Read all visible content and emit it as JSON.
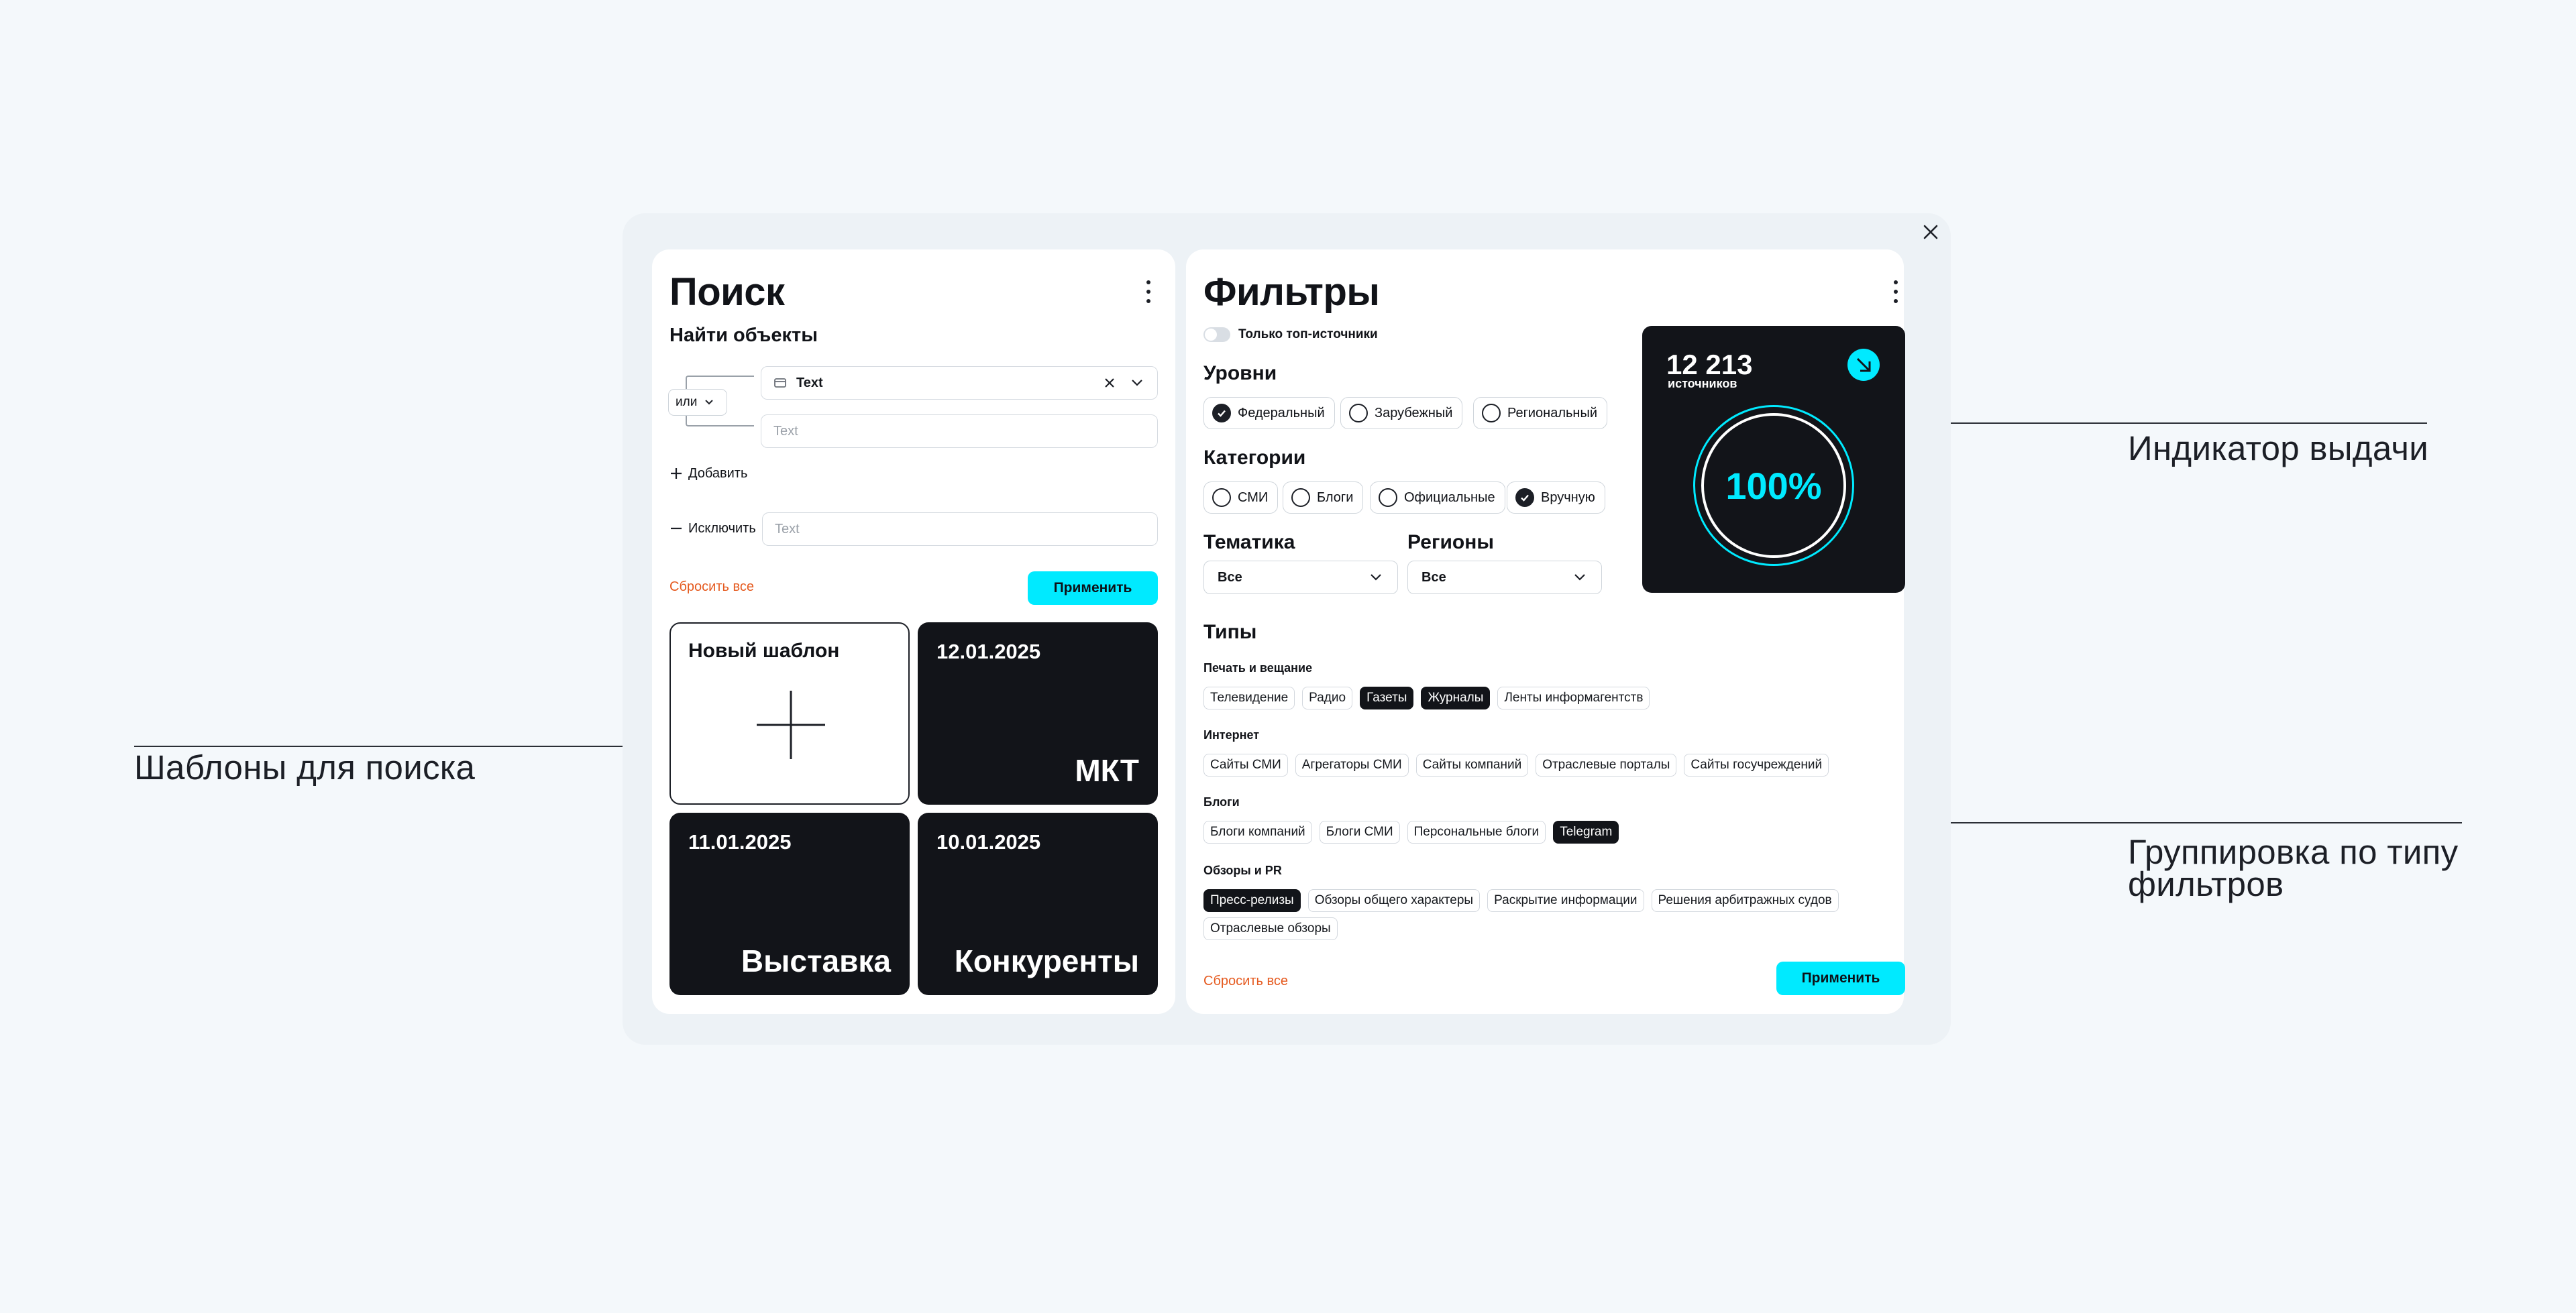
{
  "annotations": {
    "templates": "Шаблоны для поиска",
    "indicator": "Индикатор выдачи",
    "grouping_line1": "Группировка по типу",
    "grouping_line2": "фильтров"
  },
  "search": {
    "title": "Поиск",
    "subtitle": "Найти объекты",
    "logic_operator": "или",
    "field1_value": "Text",
    "field2_placeholder": "Text",
    "add_label": "Добавить",
    "exclude_label": "Исключить",
    "exclude_placeholder": "Text",
    "reset_label": "Сбросить все",
    "apply_label": "Применить",
    "templates": [
      {
        "title": "Новый шаблон"
      },
      {
        "date": "12.01.2025",
        "name": "МКТ"
      },
      {
        "date": "11.01.2025",
        "name": "Выставка"
      },
      {
        "date": "10.01.2025",
        "name": "Конкуренты"
      }
    ]
  },
  "filters": {
    "title": "Фильтры",
    "top_sources_label": "Только топ-источники",
    "top_sources_enabled": false,
    "levels": {
      "title": "Уровни",
      "options": [
        {
          "label": "Федеральный",
          "checked": true
        },
        {
          "label": "Зарубежный",
          "checked": false
        },
        {
          "label": "Региональный",
          "checked": false
        }
      ]
    },
    "categories": {
      "title": "Категории",
      "options": [
        {
          "label": "СМИ",
          "checked": false
        },
        {
          "label": "Блоги",
          "checked": false
        },
        {
          "label": "Официальные",
          "checked": false
        },
        {
          "label": "Вручную",
          "checked": true
        }
      ]
    },
    "topic": {
      "title": "Тематика",
      "value": "Все"
    },
    "regions": {
      "title": "Регионы",
      "value": "Все"
    },
    "indicator": {
      "count": "12 213",
      "unit": "источников",
      "percent": "100%",
      "percent_value": 100,
      "accent": "#00eaff"
    },
    "types": {
      "title": "Типы",
      "groups": [
        {
          "name": "Печать и вещание",
          "chips": [
            {
              "label": "Телевидение",
              "on": false
            },
            {
              "label": "Радио",
              "on": false
            },
            {
              "label": "Газеты",
              "on": true
            },
            {
              "label": "Журналы",
              "on": true
            },
            {
              "label": "Ленты информагентств",
              "on": false
            }
          ]
        },
        {
          "name": "Интернет",
          "chips": [
            {
              "label": "Сайты СМИ",
              "on": false
            },
            {
              "label": "Агрегаторы СМИ",
              "on": false
            },
            {
              "label": "Сайты компаний",
              "on": false
            },
            {
              "label": "Отраслевые порталы",
              "on": false
            },
            {
              "label": "Сайты госучреждений",
              "on": false
            }
          ]
        },
        {
          "name": "Блоги",
          "chips": [
            {
              "label": "Блоги компаний",
              "on": false
            },
            {
              "label": "Блоги СМИ",
              "on": false
            },
            {
              "label": "Персональные блоги",
              "on": false
            },
            {
              "label": "Telegram",
              "on": true
            }
          ]
        },
        {
          "name": "Обзоры и PR",
          "chips": [
            {
              "label": "Пресс-релизы",
              "on": true
            },
            {
              "label": "Обзоры общего характеры",
              "on": false
            },
            {
              "label": "Раскрытие информации",
              "on": false
            },
            {
              "label": "Решения арбитражных судов",
              "on": false
            }
          ],
          "chips_row2": [
            {
              "label": "Отраслевые обзоры",
              "on": false
            }
          ]
        }
      ]
    },
    "reset_label": "Сбросить все",
    "apply_label": "Применить"
  }
}
